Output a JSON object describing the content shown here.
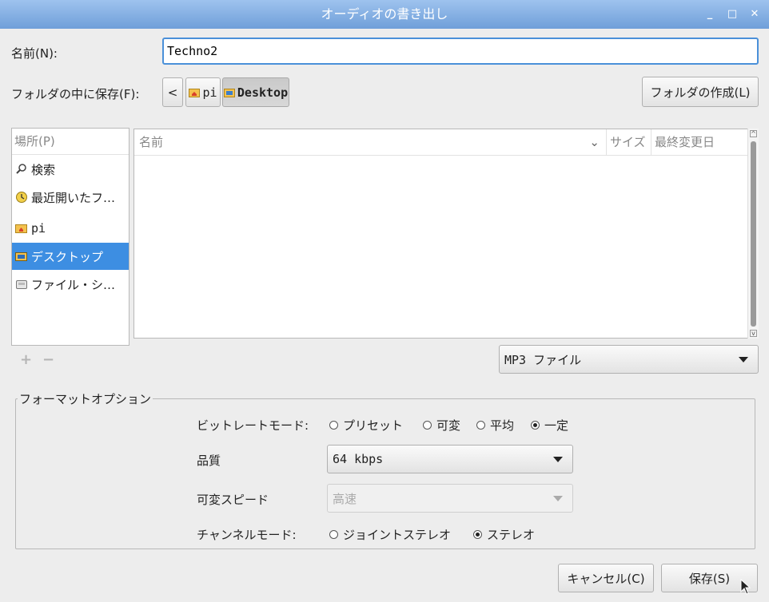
{
  "window": {
    "title": "オーディオの書き出し",
    "controls": {
      "minimize": "_",
      "maximize": "□",
      "close": "✕"
    }
  },
  "name_label": "名前(N):",
  "name_value": "Techno2",
  "save_in_label": "フォルダの中に保存(F):",
  "breadcrumb": {
    "back": "<",
    "items": [
      {
        "label": "pi"
      },
      {
        "label": "Desktop"
      }
    ]
  },
  "create_folder_label": "フォルダの作成(L)",
  "places": {
    "header": "場所(P)",
    "items": [
      {
        "label": "検索",
        "icon": "search-icon"
      },
      {
        "label": "最近開いたフ…",
        "icon": "recent-icon"
      },
      {
        "label": "pi",
        "icon": "home-folder-icon"
      },
      {
        "label": "デスクトップ",
        "icon": "desktop-folder-icon"
      },
      {
        "label": "ファイル・シ…",
        "icon": "drive-icon"
      }
    ],
    "add": "+",
    "remove": "−"
  },
  "files": {
    "columns": {
      "name": "名前",
      "size": "サイズ",
      "modified": "最終変更日"
    },
    "rows": []
  },
  "filter": {
    "selected": "MP3 ファイル"
  },
  "format_options": {
    "legend": "フォーマットオプション",
    "bitrate_mode": {
      "label": "ビットレートモード:",
      "options": [
        "プリセット",
        "可変",
        "平均",
        "一定"
      ],
      "selected": "一定"
    },
    "quality": {
      "label": "品質",
      "value": "64 kbps"
    },
    "variable_speed": {
      "label": "可変スピード",
      "value": "高速"
    },
    "channel_mode": {
      "label": "チャンネルモード:",
      "options": [
        "ジョイントステレオ",
        "ステレオ"
      ],
      "selected": "ステレオ"
    }
  },
  "buttons": {
    "cancel": "キャンセル(C)",
    "save": "保存(S)"
  },
  "colors": {
    "selection": "#3d8ee2",
    "titlebar": "#7fa9dd",
    "focus": "#4a90d9"
  }
}
